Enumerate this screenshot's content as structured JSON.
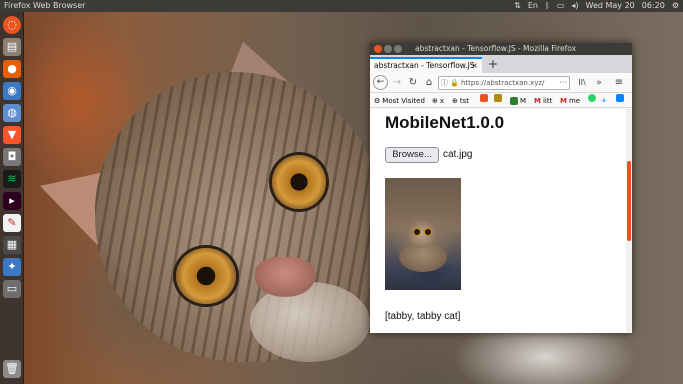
{
  "top_panel": {
    "app_title": "Firefox Web Browser",
    "clock": "Wed May 20",
    "time": "06:20"
  },
  "launcher": {
    "items": [
      "files",
      "firefox",
      "software",
      "ubuntu-browser",
      "brave",
      "screenshot",
      "spotify",
      "terminal",
      "editor",
      "workspace",
      "store",
      "drive",
      "trash"
    ]
  },
  "window": {
    "title": "abstractxan - Tensorflow.JS - Mozilla Firefox"
  },
  "tab": {
    "label": "abstractxan - Tensorflow.JS",
    "close": "×",
    "new_tab": "+"
  },
  "navbar": {
    "url": "https://abstractxan.xyz/",
    "url_more": "···",
    "library": "II\\",
    "overflow": "»",
    "menu": "≡"
  },
  "bookmarks": {
    "items": [
      {
        "label": "Most Visited",
        "color": "#555555"
      },
      {
        "label": "x",
        "color": "#333333"
      },
      {
        "label": "tst",
        "color": "#333333"
      },
      {
        "label": "",
        "color": "#e95420"
      },
      {
        "label": "",
        "color": "#b8860b"
      },
      {
        "label": "M",
        "color": "#2e7d32"
      },
      {
        "label": "iitt",
        "color": "#c62828"
      },
      {
        "label": "me",
        "color": "#c62828"
      },
      {
        "label": "",
        "color": "#25d366"
      },
      {
        "label": "",
        "color": "#1da1f2"
      },
      {
        "label": "",
        "color": "#0a84ff"
      }
    ]
  },
  "page": {
    "heading": "MobileNet1.0.0",
    "browse_label": "Browse...",
    "file_name": "cat.jpg",
    "prediction": "[tabby, tabby cat]"
  },
  "colors": {
    "accent": "#e95420",
    "panel": "#3c3b37",
    "tab_highlight": "#0a84ff"
  }
}
